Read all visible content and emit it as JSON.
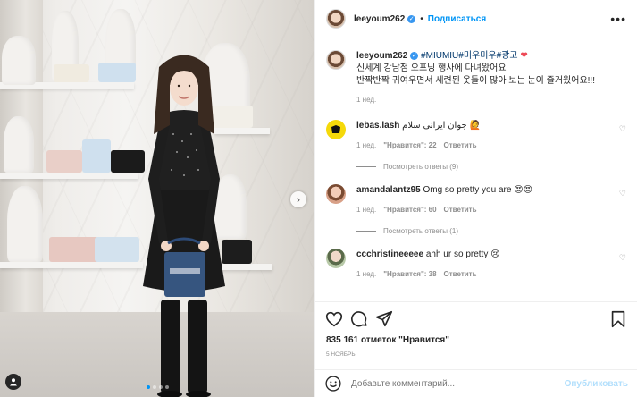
{
  "post": {
    "username": "leeyoum262",
    "follow_label": "Подписаться",
    "separator": "•",
    "caption_hashtags": "#MIUMIU#미우미우#광고",
    "caption_line1": "신세계 강남점 오프닝 행사에 다녀왔어요",
    "caption_line2": "반짝반짝 귀여우면서 세련된 옷들이 많아 보는 눈이 즐거웠어요!!!",
    "caption_time": "1 нед.",
    "likes_count": "835 161",
    "likes_label": "отметок \"Нравится\"",
    "date": "5 НОЯБРЬ",
    "add_comment_placeholder": "Добавьте комментарий...",
    "publish_label": "Опубликовать",
    "carousel_index": 1,
    "carousel_total": 4
  },
  "comments": [
    {
      "username": "lebas.lash",
      "text": "جوان ایرانی سلام 🙋",
      "time": "1 нед.",
      "likes": "\"Нравится\": 22",
      "reply_label": "Ответить",
      "view_replies": "Посмотреть ответы (9)",
      "avatar_color": "#f5d90a"
    },
    {
      "username": "amandalantz95",
      "text": "Omg so pretty you are 😍😍",
      "time": "1 нед.",
      "likes": "\"Нравится\": 60",
      "reply_label": "Ответить",
      "view_replies": "Посмотреть ответы (1)",
      "avatar_color": "#d8a087"
    },
    {
      "username": "ccchristineeeee",
      "text": "ahh ur so pretty 😢",
      "time": "1 нед.",
      "likes": "\"Нравится\": 38",
      "reply_label": "Ответить",
      "avatar_color": "#b8c9a8"
    }
  ],
  "icons": {
    "more": "more-horizontal-icon",
    "like": "heart-icon",
    "comment": "comment-icon",
    "share": "share-icon",
    "save": "bookmark-icon",
    "emoji": "smiley-icon",
    "next": "chevron-right-icon",
    "tag": "user-tag-icon"
  },
  "colors": {
    "accent": "#0095f6",
    "verified": "#3897f0",
    "secondary_text": "#8e8e8e"
  }
}
